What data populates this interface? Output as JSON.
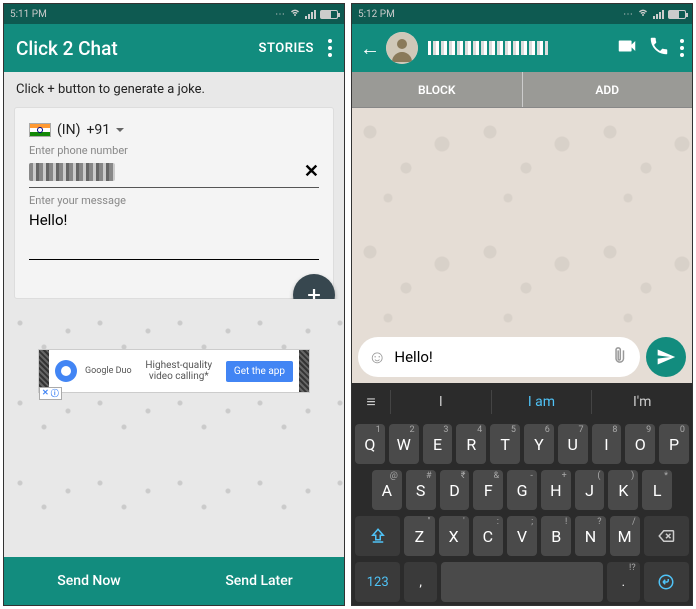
{
  "phone1": {
    "status_time": "5:11 PM",
    "app_title": "Click 2 Chat",
    "stories": "STORIES",
    "tip": "Click + button to generate a joke.",
    "country": "(IN)",
    "dialcode": "+91",
    "phone_label": "Enter phone number",
    "msg_label": "Enter your message",
    "msg_value": "Hello!",
    "ad_brand": "Google Duo",
    "ad_text": "Highest-quality video calling*",
    "ad_cta": "Get the app",
    "send_now": "Send Now",
    "send_later": "Send Later"
  },
  "phone2": {
    "status_time": "5:12 PM",
    "block": "BLOCK",
    "add": "ADD",
    "msg_value": "Hello!",
    "sugg1": "I",
    "sugg2": "I am",
    "sugg3": "I'm",
    "sym": "123",
    "row1": [
      "Q",
      "W",
      "E",
      "R",
      "T",
      "Y",
      "U",
      "I",
      "O",
      "P"
    ],
    "row1m": [
      "1",
      "2",
      "3",
      "4",
      "5",
      "6",
      "7",
      "8",
      "9",
      "0"
    ],
    "row2": [
      "A",
      "S",
      "D",
      "F",
      "G",
      "H",
      "J",
      "K",
      "L"
    ],
    "row2m": [
      "@",
      "#",
      "₹",
      "&",
      "-",
      "+",
      "(",
      ")",
      "*"
    ],
    "row3": [
      "Z",
      "X",
      "C",
      "V",
      "B",
      "N",
      "M"
    ],
    "row3m": [
      "\"",
      "'",
      ":",
      ";",
      "!",
      "?",
      "/"
    ]
  }
}
